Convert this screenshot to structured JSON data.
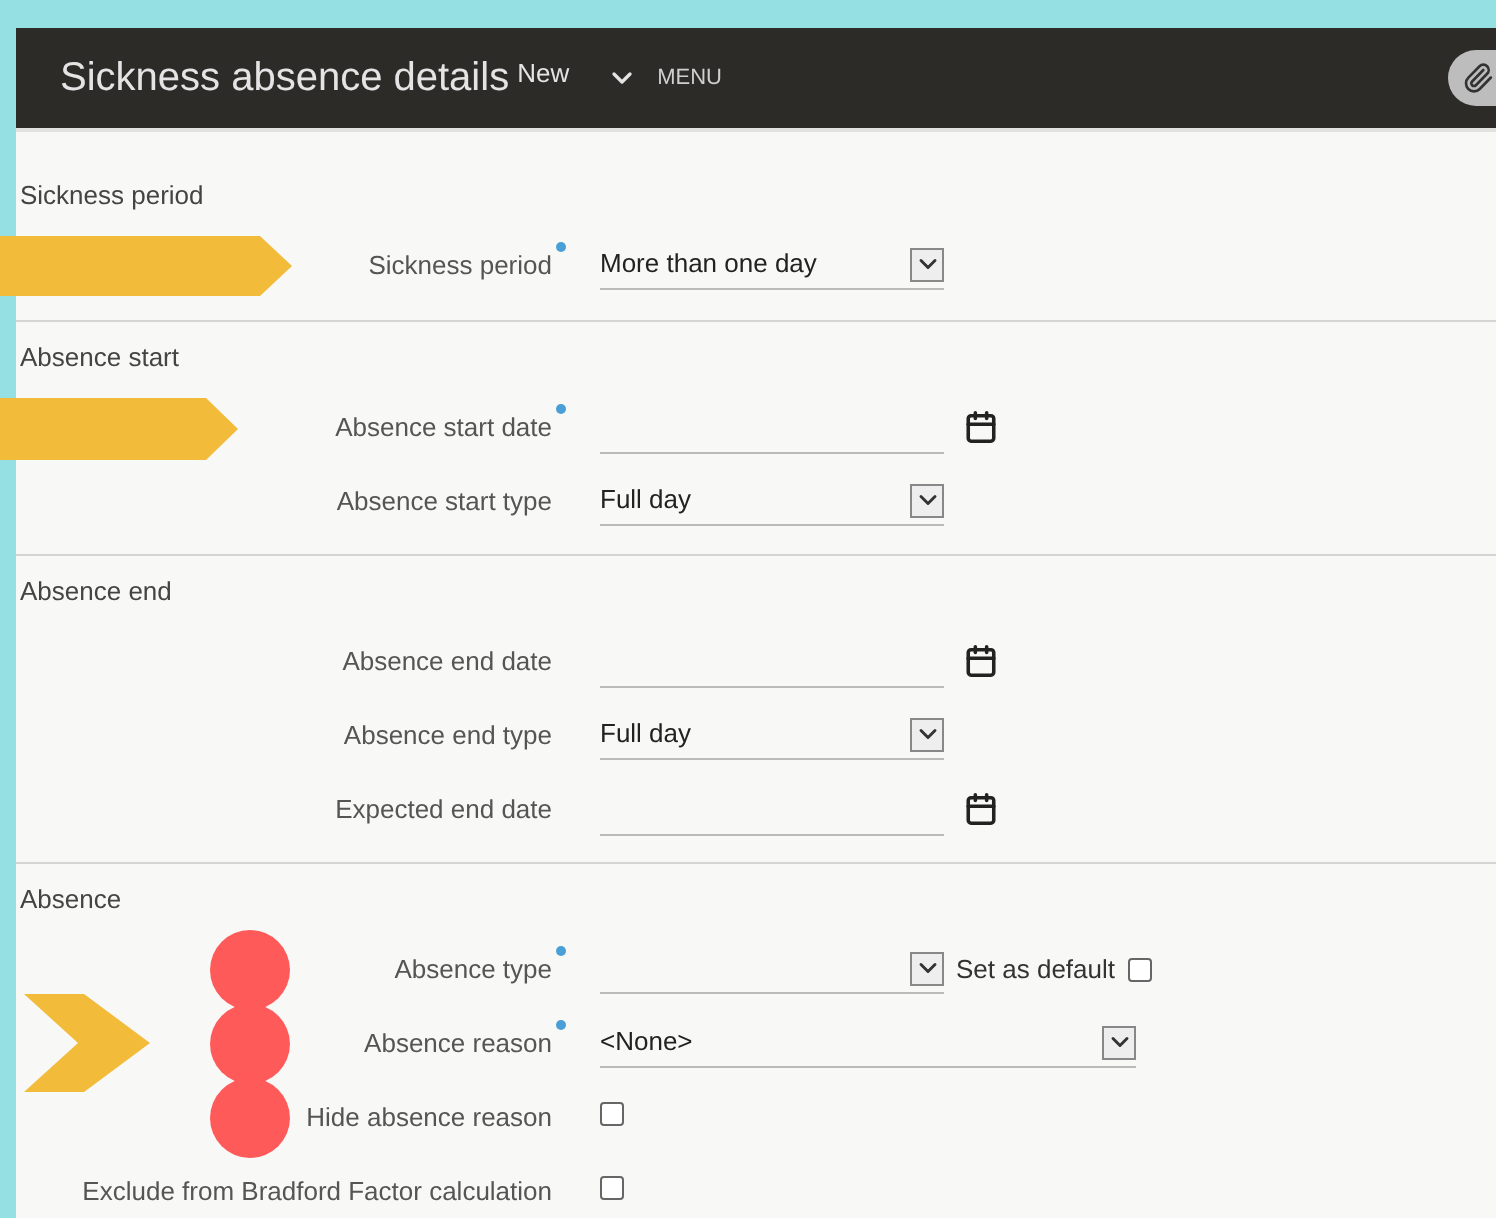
{
  "header": {
    "title": "Sickness absence details",
    "status": "New",
    "menu": "MENU"
  },
  "sections": [
    {
      "title": "Sickness period",
      "fields": [
        {
          "kind": "select",
          "label": "Sickness period",
          "required": true,
          "value": "More than one day",
          "markers": [
            {
              "kind": "long-arrow"
            }
          ]
        }
      ]
    },
    {
      "title": "Absence start",
      "fields": [
        {
          "kind": "date",
          "label": "Absence start date",
          "required": true,
          "markers": [
            {
              "kind": "arrow"
            }
          ]
        },
        {
          "kind": "select",
          "label": "Absence start type",
          "required": false,
          "value": "Full day"
        }
      ]
    },
    {
      "title": "Absence end",
      "fields": [
        {
          "kind": "date",
          "label": "Absence end date",
          "required": false
        },
        {
          "kind": "select",
          "label": "Absence end type",
          "required": false,
          "value": "Full day"
        },
        {
          "kind": "date",
          "label": "Expected end date",
          "required": false
        }
      ]
    },
    {
      "title": "Absence",
      "fields": [
        {
          "kind": "select-default",
          "label": "Absence type",
          "required": true,
          "default_label": "Set as default",
          "default_checked": false,
          "markers": [
            {
              "kind": "dot"
            }
          ]
        },
        {
          "kind": "wide-select",
          "label": "Absence reason",
          "required": true,
          "value": "<None>",
          "markers": [
            {
              "kind": "chevron"
            },
            {
              "kind": "dot"
            }
          ]
        },
        {
          "kind": "checkbox",
          "label": "Hide absence reason",
          "required": false,
          "checked": false,
          "markers": [
            {
              "kind": "dot"
            }
          ]
        },
        {
          "kind": "checkbox",
          "label": "Exclude from Bradford Factor calculation",
          "required": false,
          "checked": false
        }
      ]
    }
  ]
}
